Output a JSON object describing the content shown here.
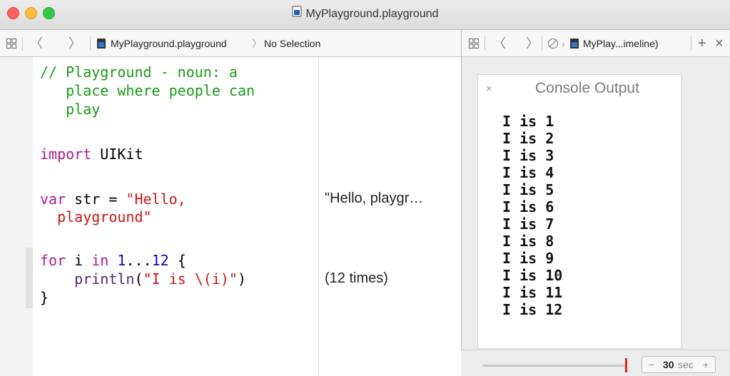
{
  "window": {
    "title": "MyPlayground.playground"
  },
  "jumpbar_left": {
    "file": "MyPlayground.playground",
    "selection": "No Selection",
    "crumb_sep": "〉"
  },
  "jumpbar_right": {
    "file": "MyPlay...imeline)",
    "crumb_sep": "›",
    "add_label": "+",
    "close_label": "×"
  },
  "nav": {
    "back": "〈",
    "forward": "〉"
  },
  "code": {
    "comment_l1": "// Playground - noun: a",
    "comment_l2": "   place where people can",
    "comment_l3": "   play",
    "import_kw": "import",
    "import_mod": " UIKit",
    "var_kw": "var",
    "var_rest": " str = ",
    "str_l1": "\"Hello,",
    "str_l2": "  playground\"",
    "for_kw": "for",
    "for_i": " i ",
    "in_kw": "in",
    "range_start": " 1",
    "range_op": "...",
    "range_end": "12",
    "brace_open": " {",
    "println_indent": "    ",
    "println_fn": "println",
    "println_paren_open": "(",
    "println_str": "\"I is \\(i)\"",
    "println_paren_close": ")",
    "brace_close": "}"
  },
  "results": {
    "str_result": "\"Hello, playgr…",
    "loop_result": "(12 times)"
  },
  "console": {
    "close": "×",
    "title": "Console Output",
    "lines": [
      "I is 1",
      "I is 2",
      "I is 3",
      "I is 4",
      "I is 5",
      "I is 6",
      "I is 7",
      "I is 8",
      "I is 9",
      "I is 10",
      "I is 11",
      "I is 12"
    ]
  },
  "timeline": {
    "minus": "−",
    "duration_value": "30",
    "duration_unit": "sec",
    "plus": "+",
    "scrubber_position": 1.0
  },
  "colors": {
    "comment": "#1a9a1a",
    "keyword": "#b0188c",
    "string": "#c41a16",
    "number": "#1c00cf",
    "scrubber": "#e62020"
  }
}
